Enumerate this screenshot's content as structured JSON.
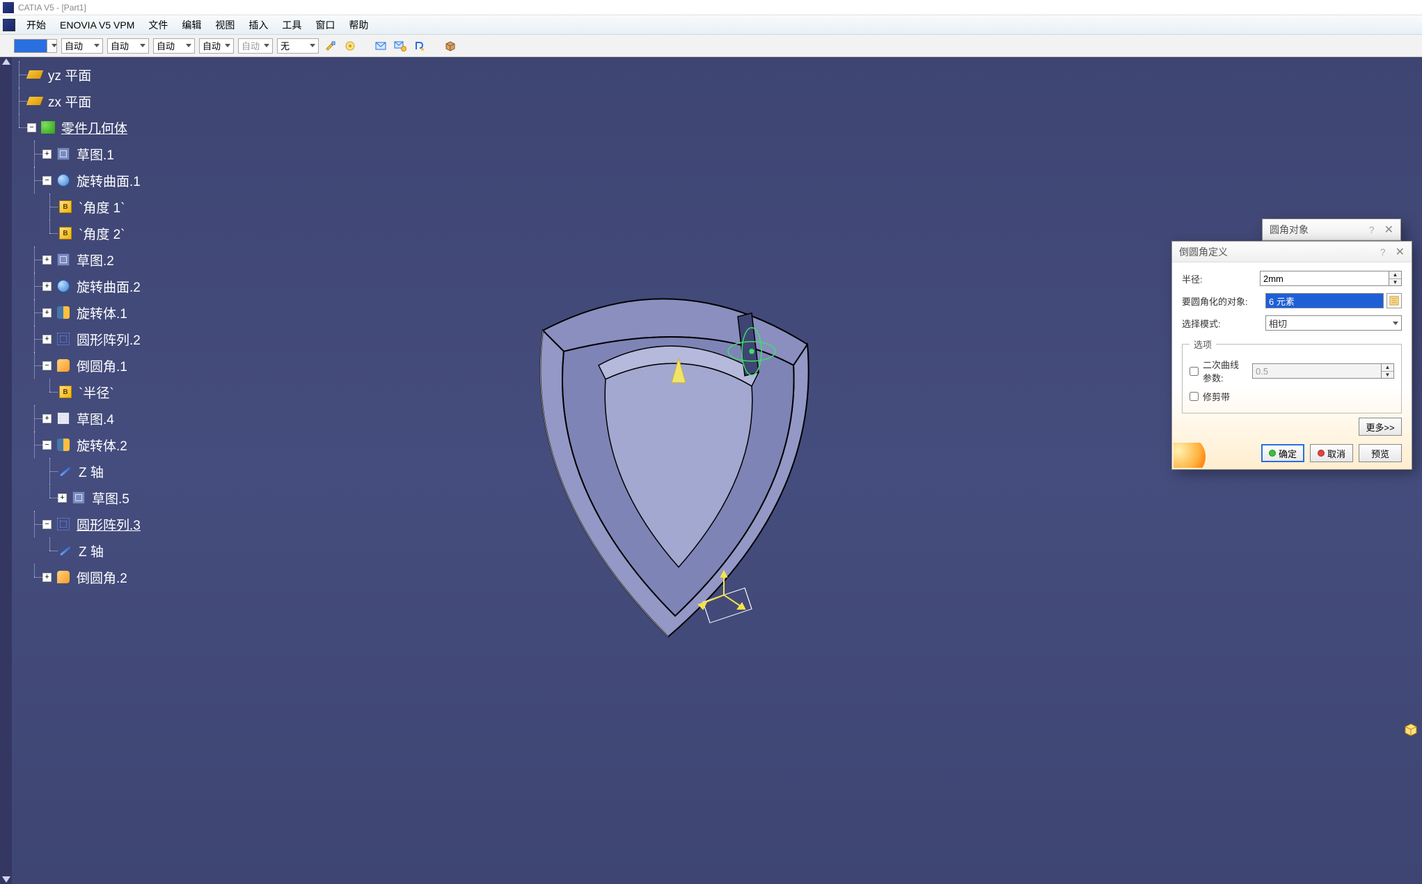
{
  "window": {
    "title": "CATIA V5 - [Part1]"
  },
  "menu": {
    "items": [
      "开始",
      "ENOVIA V5 VPM",
      "文件",
      "编辑",
      "视图",
      "插入",
      "工具",
      "窗口",
      "帮助"
    ]
  },
  "toolbar": {
    "auto": "自动",
    "none": "无"
  },
  "tree": {
    "yz": "yz 平面",
    "zx": "zx 平面",
    "partbody": "零件几何体",
    "sketch1": "草图.1",
    "revolveSurf1": "旋转曲面.1",
    "angle1": "`角度 1`",
    "angle2": "`角度 2`",
    "sketch2": "草图.2",
    "revolveSurf2": "旋转曲面.2",
    "revolveBody1": "旋转体.1",
    "pattern2": "圆形阵列.2",
    "fillet1": "倒圆角.1",
    "radius": "`半径`",
    "sketch4": "草图.4",
    "revolveBody2": "旋转体.2",
    "zaxis": "Z 轴",
    "sketch5": "草图.5",
    "pattern3": "圆形阵列.3",
    "zaxis2": "Z 轴",
    "fillet2": "倒圆角.2"
  },
  "dlg_behind": {
    "title": "圆角对象"
  },
  "dlg": {
    "title": "倒圆角定义",
    "radius_lbl": "半径:",
    "radius_val": "2mm",
    "objects_lbl": "要圆角化的对象:",
    "objects_val": "6 元素",
    "mode_lbl": "选择模式:",
    "mode_val": "相切",
    "options_legend": "选项",
    "conic_lbl": "二次曲线参数:",
    "conic_val": "0.5",
    "trim_lbl": "修剪带",
    "more": "更多>>",
    "ok": "确定",
    "cancel": "取消",
    "preview": "预览"
  }
}
